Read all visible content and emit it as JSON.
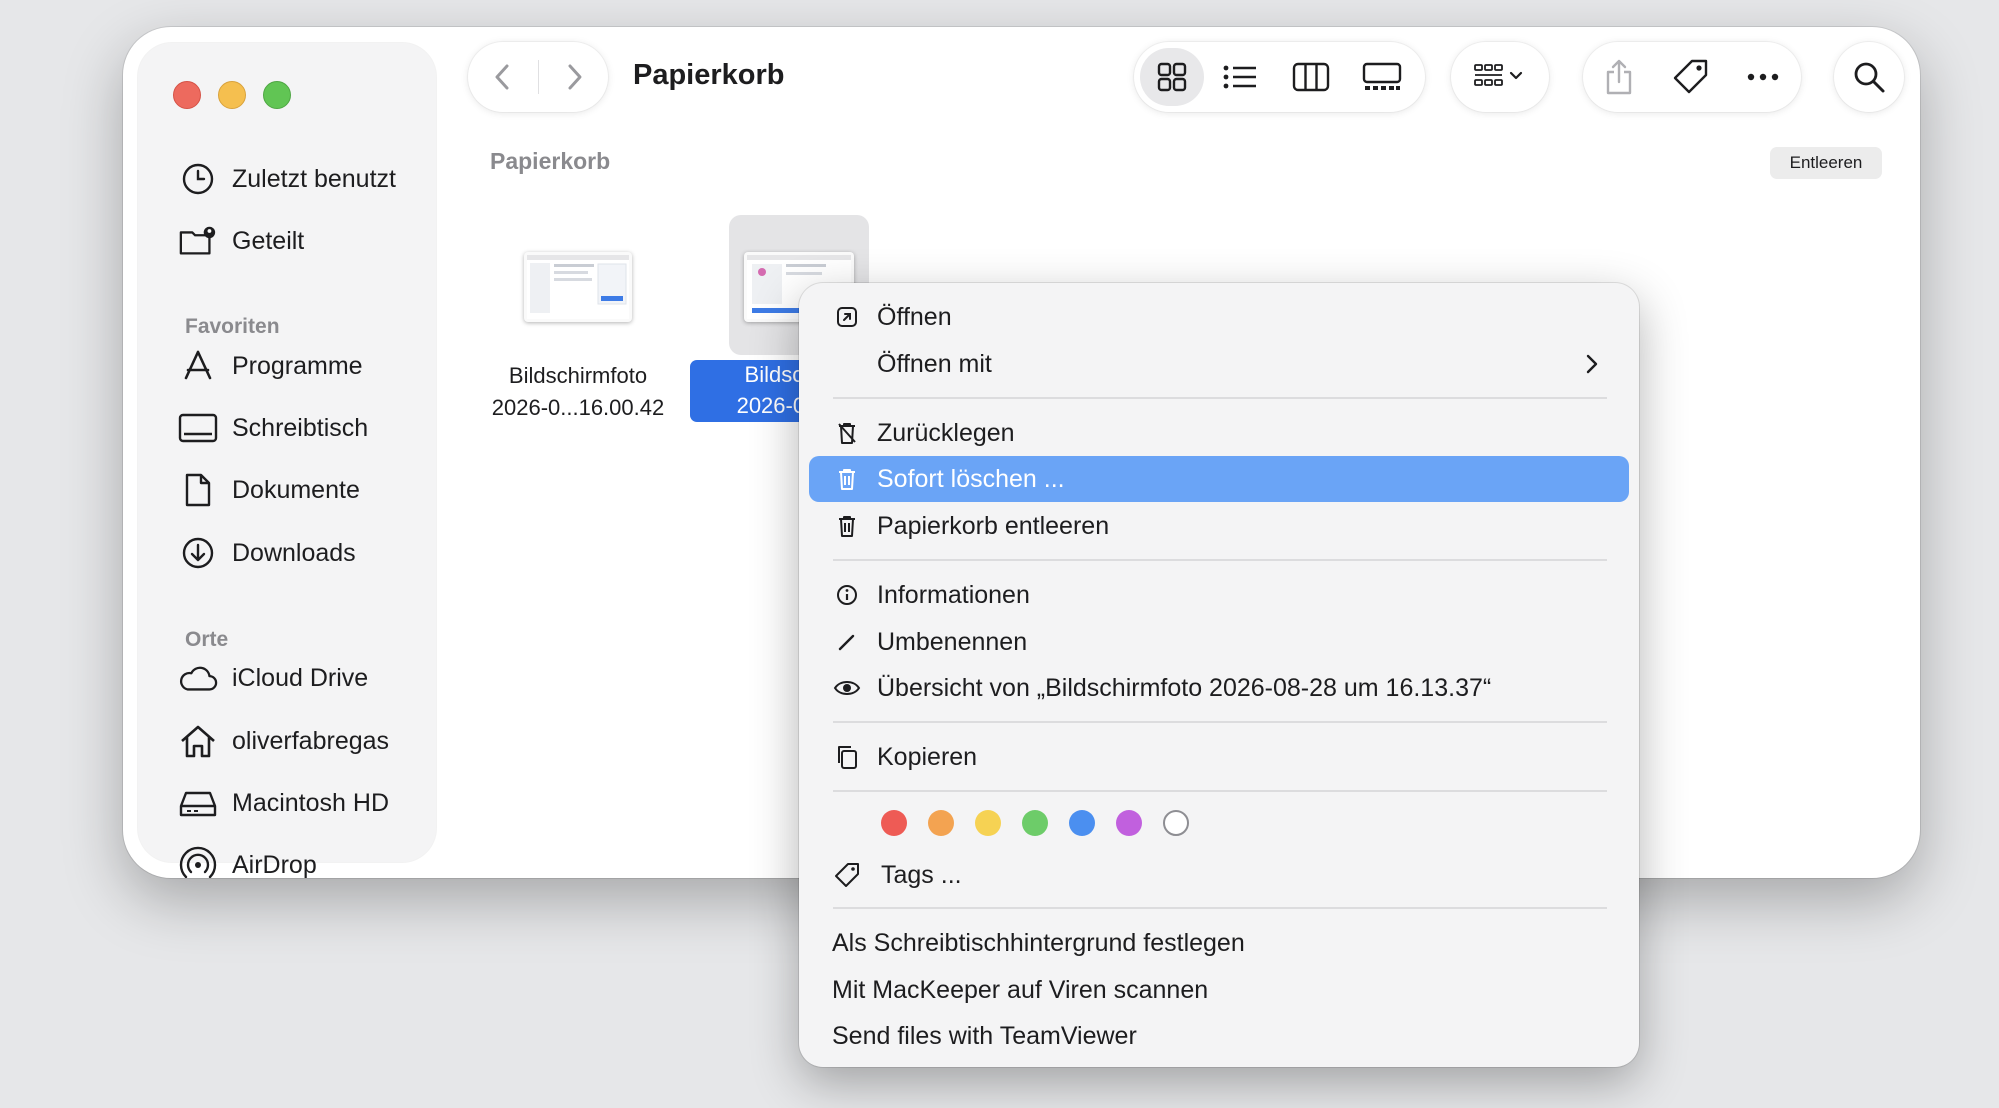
{
  "window": {
    "title": "Papierkorb",
    "breadcrumb": "Papierkorb",
    "empty_button": "Entleeren"
  },
  "toolbar": {
    "back_icon": "chevron-left-icon",
    "forward_icon": "chevron-right-icon",
    "view_icons": [
      "icon-view-icon",
      "list-view-icon",
      "column-view-icon",
      "gallery-view-icon"
    ],
    "group_icon": "group-by-icon",
    "share_icon": "share-icon",
    "tag_icon": "tag-icon",
    "more_icon": "more-icon",
    "search_icon": "search-icon"
  },
  "sidebar": {
    "top_items": [
      {
        "label": "Zuletzt benutzt",
        "icon": "clock-icon"
      },
      {
        "label": "Geteilt",
        "icon": "shared-folder-icon"
      }
    ],
    "favorites_heading": "Favoriten",
    "favorites": [
      {
        "label": "Programme",
        "icon": "applications-icon"
      },
      {
        "label": "Schreibtisch",
        "icon": "desktop-icon"
      },
      {
        "label": "Dokumente",
        "icon": "document-icon"
      },
      {
        "label": "Downloads",
        "icon": "download-icon"
      }
    ],
    "locations_heading": "Orte",
    "locations": [
      {
        "label": "iCloud Drive",
        "icon": "cloud-icon"
      },
      {
        "label": "oliverfabregas",
        "icon": "home-icon"
      },
      {
        "label": "Macintosh HD",
        "icon": "disk-icon"
      },
      {
        "label": "AirDrop",
        "icon": "airdrop-icon"
      }
    ]
  },
  "files": [
    {
      "line1": "Bildschirmfoto",
      "line2": "2026-0...16.00.42",
      "selected": false
    },
    {
      "line1": "Bildsch",
      "line2": "2026-0...",
      "selected": true
    }
  ],
  "context_menu": {
    "items": {
      "open": "Öffnen",
      "open_with": "Öffnen mit",
      "put_back": "Zurücklegen",
      "delete_now": "Sofort löschen ...",
      "empty_trash": "Papierkorb entleeren",
      "info": "Informationen",
      "rename": "Umbenennen",
      "quicklook": "Übersicht von „Bildschirmfoto 2026-08-28 um 16.13.37“",
      "copy": "Kopieren",
      "tags": "Tags ...",
      "set_wallpaper": "Als Schreibtischhintergrund festlegen",
      "mackeeper": "Mit MacKeeper auf Viren scannen",
      "teamviewer": "Send files with TeamViewer"
    },
    "highlighted": "delete_now",
    "tag_colors": [
      "#ee5b55",
      "#f3a351",
      "#f6d253",
      "#6dcc69",
      "#4b8ff0",
      "#c160de",
      "#ffffff"
    ],
    "highlight_color": "#6aa4f6"
  }
}
